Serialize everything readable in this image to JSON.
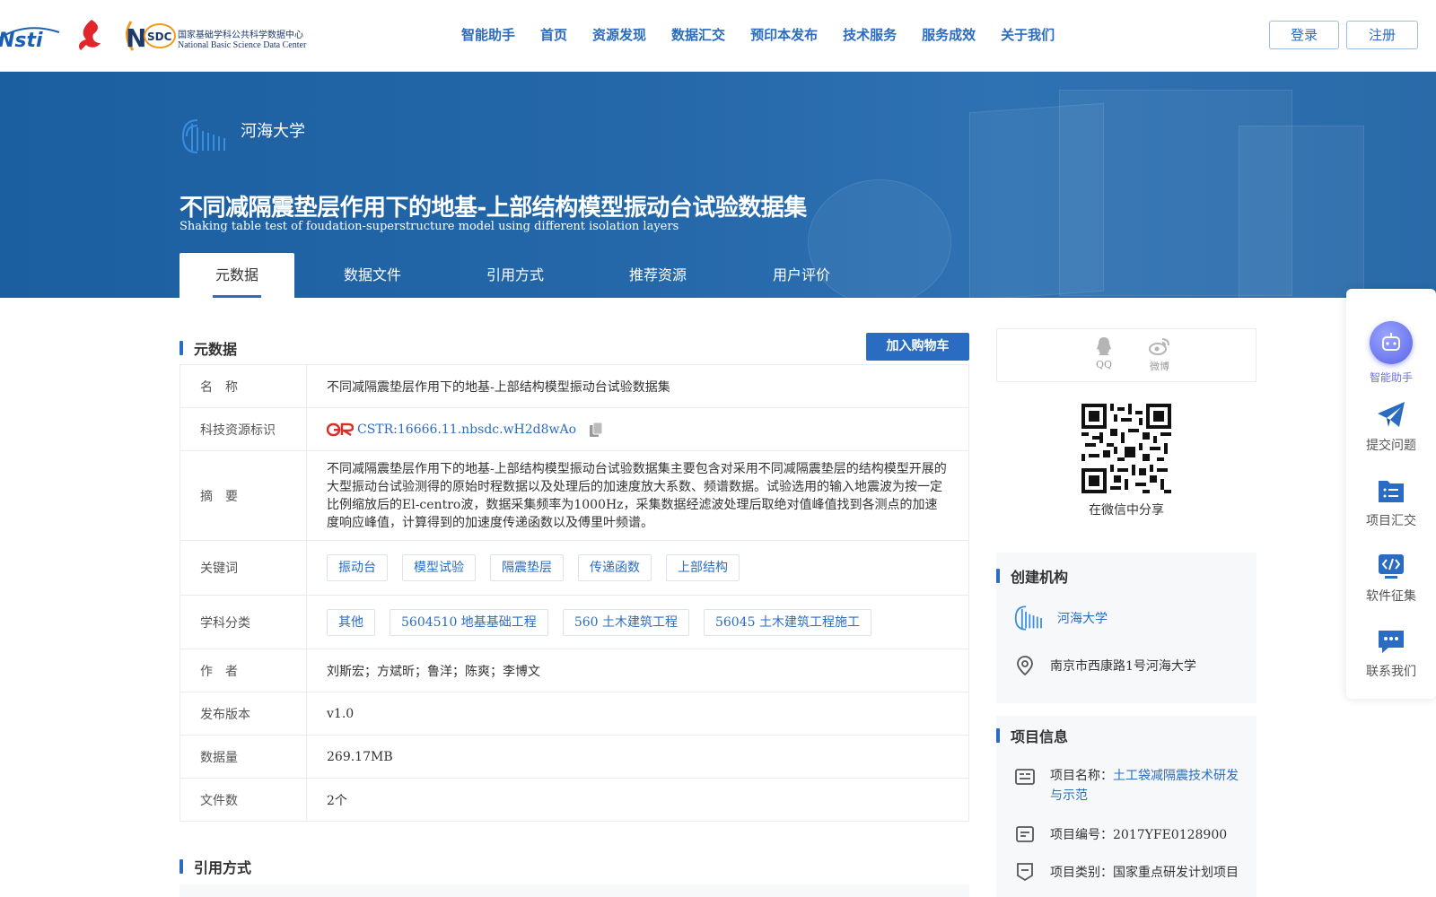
{
  "header": {
    "logos": [
      "nsti-logo",
      "red-logo",
      "nsdc-logo"
    ],
    "nsdc_cn": "国家基础学科公共科学数据中心",
    "nsdc_en": "National Basic Science Data Center",
    "nsdc_abbr": "SDC",
    "nav": [
      "智能助手",
      "首页",
      "资源发现",
      "数据汇交",
      "预印本发布",
      "技术服务",
      "服务成效",
      "关于我们"
    ],
    "login": "登录",
    "register": "注册"
  },
  "banner": {
    "institution": "河海大学",
    "title": "不同减隔震垫层作用下的地基-上部结构模型振动台试验数据集",
    "subtitle": "Shaking table test of foudation-superstructure model using different isolation layers",
    "tabs": [
      "元数据",
      "数据文件",
      "引用方式",
      "推荐资源",
      "用户评价"
    ]
  },
  "metadata": {
    "section_title": "元数据",
    "cart_button": "加入购物车",
    "name_label": "名　称",
    "name": "不同减隔震垫层作用下的地基-上部结构模型振动台试验数据集",
    "cstr_label": "科技资源标识",
    "cstr": "CSTR:16666.11.nbsdc.wH2d8wAo",
    "abstract_label": "摘　要",
    "abstract": "不同减隔震垫层作用下的地基-上部结构模型振动台试验数据集主要包含对采用不同减隔震垫层的结构模型开展的大型振动台试验测得的原始时程数据以及处理后的加速度放大系数、频谱数据。试验选用的输入地震波为按一定比例缩放后的El-centro波，数据采集频率为1000Hz，采集数据经滤波处理后取绝对值峰值找到各测点的加速度响应峰值，计算得到的加速度传递函数以及傅里叶频谱。",
    "keywords_label": "关键词",
    "keywords": [
      "振动台",
      "模型试验",
      "隔震垫层",
      "传递函数",
      "上部结构"
    ],
    "subjects_label": "学科分类",
    "subjects": [
      "其他",
      "5604510 地基基础工程",
      "560 土木建筑工程",
      "56045 土木建筑工程施工"
    ],
    "authors_label": "作　者",
    "authors": "刘斯宏；方斌昕；鲁洋；陈爽；李博文",
    "version_label": "发布版本",
    "version": "v1.0",
    "size_label": "数据量",
    "size": "269.17MB",
    "files_label": "文件数",
    "files": "2个"
  },
  "citation": {
    "section_title": "引用方式"
  },
  "share": {
    "qq": "QQ",
    "weibo": "微博",
    "wechat_label": "在微信中分享"
  },
  "creator": {
    "title": "创建机构",
    "name": "河海大学",
    "address": "南京市西康路1号河海大学"
  },
  "project": {
    "title": "项目信息",
    "name_prefix": "项目名称：",
    "name": "土工袋减隔震技术研发与示范",
    "code": "项目编号：2017YFE0128900",
    "type": "项目类别：国家重点研发计划项目"
  },
  "float_bar": [
    "智能助手",
    "提交问题",
    "项目汇交",
    "软件征集",
    "联系我们"
  ],
  "colors": {
    "primary": "#2a6cc1",
    "banner": "#1f63a6",
    "assistant": "#6b6fe0"
  }
}
